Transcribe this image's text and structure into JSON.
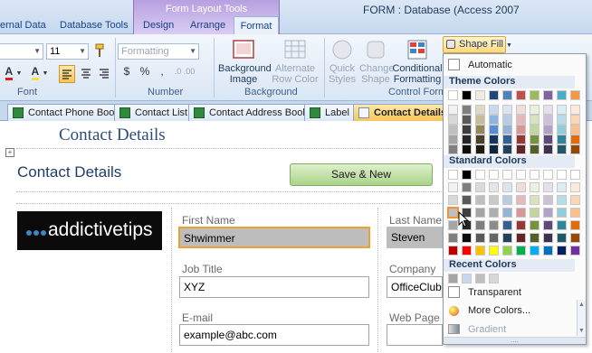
{
  "window": {
    "title": "FORM : Database (Access 2007"
  },
  "ribbon_tabs": {
    "context_group": "Form Layout Tools",
    "external_data": "ernal Data",
    "database_tools": "Database Tools",
    "design": "Design",
    "arrange": "Arrange",
    "format": "Format"
  },
  "font_group": {
    "label": "Font",
    "font_name": "",
    "font_size": "11",
    "font_color_glyph": "A",
    "fill_color_glyph": "A"
  },
  "number_group": {
    "label": "Number",
    "format_value": "Formatting",
    "currency": "$",
    "percent": "%",
    "comma": ","
  },
  "background_group": {
    "label": "Background",
    "background_image": "Background Image",
    "alternate_row_color": "Alternate Row Color"
  },
  "control_group": {
    "label": "Control Format",
    "label_short": "Control Forma",
    "quick_styles": "Quick Styles",
    "change_shape": "Change Shape",
    "conditional_formatting": "Conditional Formatting",
    "shape_fill": "Shape Fill"
  },
  "doc_tabs": [
    {
      "label": "Contact Phone Book"
    },
    {
      "label": "Contact List"
    },
    {
      "label": "Contact Address Book"
    },
    {
      "label": "Label"
    },
    {
      "label": "Contact Details"
    }
  ],
  "form": {
    "header_title": "Contact Details",
    "title": "Contact Details",
    "save_new": "Save & New",
    "logo_text": "addictivetips",
    "fields": {
      "first_name_label": "First Name",
      "first_name_value": "Shwimmer",
      "last_name_label": "Last Name",
      "last_name_value": "Steven",
      "job_title_label": "Job Title",
      "job_title_value": "XYZ",
      "company_label": "Company",
      "company_value": "OfficeClub",
      "email_label": "E-mail",
      "email_value": "example@abc.com",
      "web_page_label": "Web Page"
    }
  },
  "palette": {
    "automatic": "Automatic",
    "theme_colors": "Theme Colors",
    "standard_colors": "Standard Colors",
    "recent_colors": "Recent Colors",
    "transparent": "Transparent",
    "more_colors": "More Colors...",
    "gradient": "Gradient",
    "theme_top_row": [
      "#ffffff",
      "#000000",
      "#eeece1",
      "#1f497d",
      "#4f81bd",
      "#c0504d",
      "#9bbb59",
      "#8064a2",
      "#4bacc6",
      "#f79646"
    ],
    "theme_shades": [
      [
        "#f2f2f2",
        "#7f7f7f",
        "#ddd9c3",
        "#c6d9f0",
        "#dbe5f1",
        "#f2dcdb",
        "#ebf1dd",
        "#e5e0ec",
        "#dbeef3",
        "#fdeada"
      ],
      [
        "#d8d8d8",
        "#595959",
        "#c4bd97",
        "#8db3e2",
        "#b8cce4",
        "#e5b9b7",
        "#d7e3bc",
        "#ccc1d9",
        "#b7dde8",
        "#fbd5b5"
      ],
      [
        "#bfbfbf",
        "#3f3f3f",
        "#938953",
        "#548dd4",
        "#95b3d7",
        "#d99694",
        "#c3d69b",
        "#b2a2c7",
        "#92cddc",
        "#fac08f"
      ],
      [
        "#a5a5a5",
        "#262626",
        "#494429",
        "#17365d",
        "#366092",
        "#953734",
        "#76923c",
        "#5f497a",
        "#31859b",
        "#e36c09"
      ],
      [
        "#7f7f7f",
        "#0c0c0c",
        "#1d1b10",
        "#0f243e",
        "#244061",
        "#632423",
        "#4f6128",
        "#3f3151",
        "#205867",
        "#974806"
      ]
    ],
    "standard_rows": [
      [
        "#ffffff",
        "#000000",
        "#ffffff",
        "#ffffff",
        "#ffffff",
        "#ffffff",
        "#ffffff",
        "#ffffff",
        "#ffffff",
        "#ffffff"
      ],
      [
        "#f2f2f2",
        "#7f7f7f",
        "#dadada",
        "#e6e6e6",
        "#dbe5f1",
        "#f2dcdb",
        "#ebf1dd",
        "#e5e0ec",
        "#dbeef3",
        "#fdeada"
      ],
      [
        "#d8d8d8",
        "#595959",
        "#bfbfbf",
        "#c9c9c9",
        "#b8cce4",
        "#e5b9b7",
        "#d7e3bc",
        "#ccc1d9",
        "#b7dde8",
        "#fbd5b5"
      ],
      [
        "#bfbfbf",
        "#3f3f3f",
        "#a5a5a5",
        "#aeaeae",
        "#95b3d7",
        "#d99694",
        "#c3d69b",
        "#b2a2c7",
        "#92cddc",
        "#fac08f"
      ],
      [
        "#a5a5a5",
        "#262626",
        "#7f7f7f",
        "#8c8c8c",
        "#366092",
        "#953734",
        "#76923c",
        "#5f497a",
        "#31859b",
        "#e36c09"
      ],
      [
        "#7f7f7f",
        "#0c0c0c",
        "#595959",
        "#666666",
        "#244061",
        "#632423",
        "#4f6128",
        "#3f3151",
        "#205867",
        "#974806"
      ],
      [
        "#c00000",
        "#ff0000",
        "#ffc000",
        "#ffff00",
        "#92d050",
        "#00b050",
        "#00b0f0",
        "#0070c0",
        "#002060",
        "#7030a0"
      ]
    ],
    "recent_row": [
      "#a5a5a5",
      "#c6d9f0",
      "#bfbfbf",
      "#d8d8d8"
    ],
    "selected_swatch": "#dbe5f1"
  }
}
